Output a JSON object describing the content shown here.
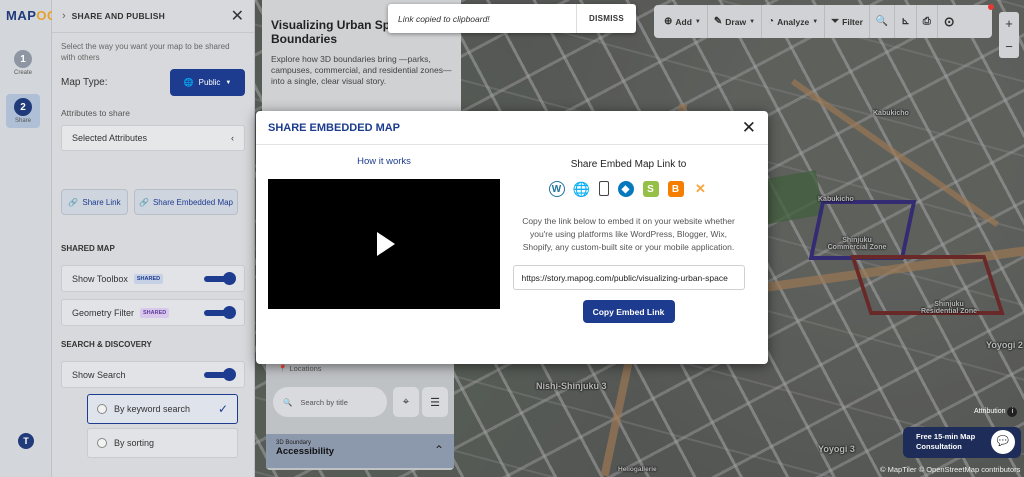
{
  "app": {
    "logo_main": "MAP",
    "logo_accent": "OG"
  },
  "rail": {
    "steps": [
      {
        "num": "1",
        "label": "Create"
      },
      {
        "num": "2",
        "label": "Share"
      }
    ],
    "avatar": "T"
  },
  "panel": {
    "title": "SHARE AND PUBLISH",
    "subtitle": "Select the way you want your map to be shared with others",
    "map_type_label": "Map Type:",
    "map_type_value": "Public",
    "attributes_label": "Attributes to share",
    "attributes_value": "Selected Attributes",
    "share_link_label": "Share Link",
    "share_embedded_label": "Share Embedded Map",
    "shared_map_heading": "SHARED MAP",
    "show_toolbox": "Show Toolbox",
    "geometry_filter": "Geometry Filter",
    "badge": "SHARED",
    "search_heading": "SEARCH & DISCOVERY",
    "show_search": "Show Search",
    "by_keyword": "By keyword search",
    "by_sorting": "By sorting"
  },
  "story": {
    "title": "Visualizing Urban Space Boundaries",
    "body": "Explore how 3D boundaries bring —parks, campuses, commercial, and residential zones—into a single, clear visual story.",
    "locations_label": "Locations",
    "search_placeholder": "Search by title",
    "section_small": "3D Boundary",
    "section_title": "Accessibility"
  },
  "toast": {
    "message": "Link copied to clipboard!",
    "dismiss": "DISMISS"
  },
  "toolbar": {
    "add": "Add",
    "draw": "Draw",
    "analyze": "Analyze",
    "filter": "Filter"
  },
  "map": {
    "labels": [
      "Kabukicho",
      "Kabukicho",
      "Shinjuku Commercial Zone",
      "Shinjuku Residential Zone",
      "Nishi-Shinjuku 3",
      "Yoyogi 3",
      "Yoyogi 2",
      "Attribution",
      "Heliogallerie"
    ],
    "consult": "Free 15-min Map Consultation",
    "credit": "© MapTiler © OpenStreetMap contributors"
  },
  "modal": {
    "title": "SHARE EMBEDDED MAP",
    "how_it_works": "How it works",
    "share_to": "Share Embed Map Link to",
    "description": "Copy the link below to embed it on your website whether you're using platforms like WordPress, Blogger, Wix, Shopify, any custom-built site or your mobile application.",
    "link": "https://story.mapog.com/public/visualizing-urban-space",
    "copy_button": "Copy Embed Link"
  }
}
